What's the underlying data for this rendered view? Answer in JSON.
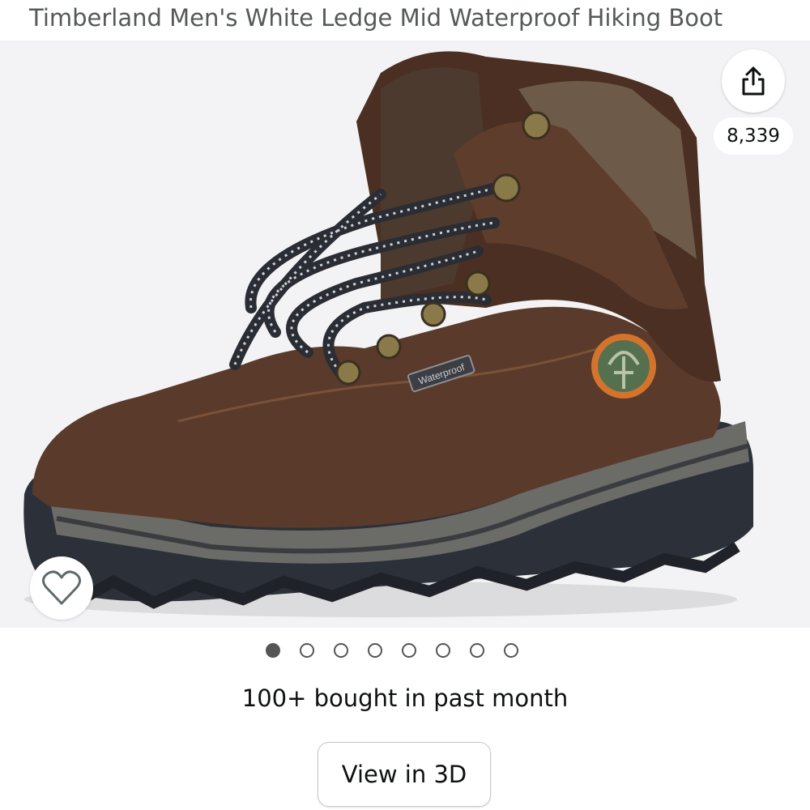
{
  "product": {
    "title": "Timberland Men's White Ledge Mid Waterproof Hiking Boot",
    "image_alt": "Brown leather mid hiking boot with lace-up hooks"
  },
  "gallery": {
    "share_icon": "share-icon",
    "share_count": "8,339",
    "favorite_icon": "heart-icon",
    "image_count": 8,
    "active_index": 0,
    "boot_badge": "Waterproof"
  },
  "sales": {
    "bought_text": "100+ bought in past month"
  },
  "actions": {
    "view_3d_label": "View in 3D"
  },
  "colors": {
    "leather": "#5a3a2a",
    "sole": "#2c3038",
    "accent_orange": "#d4742c"
  }
}
